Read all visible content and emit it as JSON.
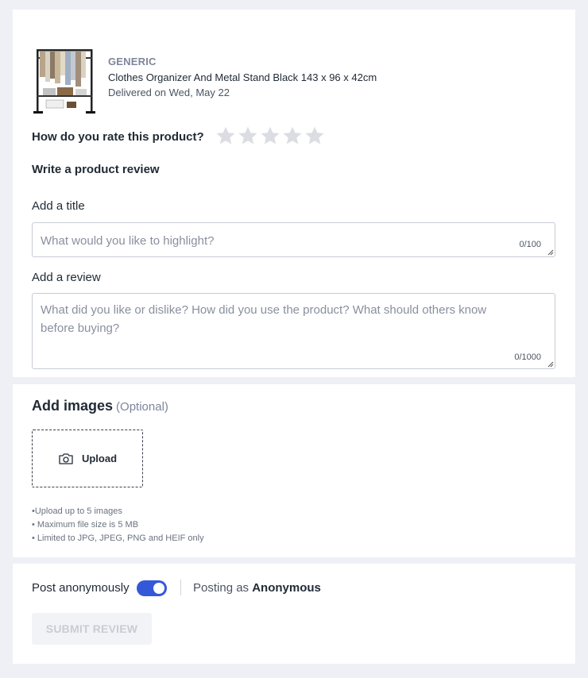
{
  "product": {
    "brand": "GENERIC",
    "name": "Clothes Organizer And Metal Stand Black 143 x 96 x 42cm",
    "delivery": "Delivered on Wed, May 22"
  },
  "rating": {
    "label": "How do you rate this product?",
    "max_stars": 5,
    "value": 0
  },
  "review_section": {
    "heading": "Write a product review",
    "title_label": "Add a title",
    "title_placeholder": "What would you like to highlight?",
    "title_counter": "0/100",
    "review_label": "Add a review",
    "review_placeholder": "What did you like or dislike? How did you use the product? What should others know before buying?",
    "review_counter": "0/1000"
  },
  "images_section": {
    "title": "Add images",
    "optional": "(Optional)",
    "upload_label": "Upload",
    "notes": [
      "•Upload up to 5 images",
      "• Maximum file size is 5 MB",
      "• Limited to JPG, JPEG, PNG and HEIF only"
    ]
  },
  "posting": {
    "anonymous_label": "Post anonymously",
    "anonymous_enabled": true,
    "posting_as_prefix": "Posting as",
    "posting_as_name": "Anonymous",
    "submit_label": "SUBMIT REVIEW"
  },
  "colors": {
    "accent": "#3558d9",
    "star_empty": "#dcdde3",
    "background": "#eef0f6"
  }
}
